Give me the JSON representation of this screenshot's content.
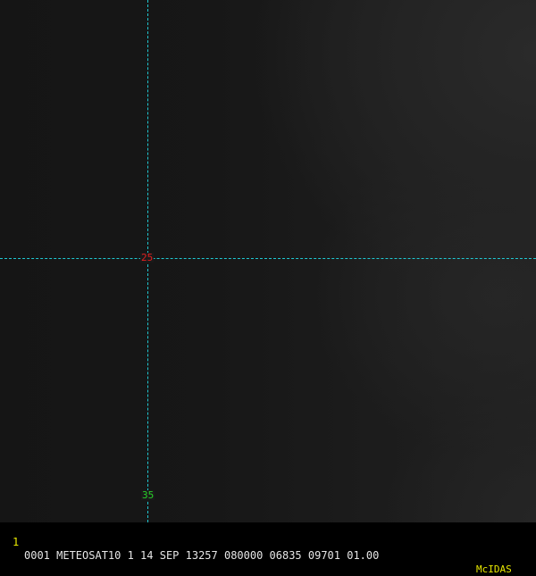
{
  "status_bar": {
    "frame_number": "1",
    "info": "0001 METEOSAT10 1 14 SEP 13257 080000 06835 09701 01.00",
    "brand": "McIDAS"
  },
  "grid_labels": {
    "lat_25": "25",
    "lat_35": "35"
  },
  "colors": {
    "grid_line": "#1fc8d2",
    "label_25": "#e02020",
    "label_35": "#28d028",
    "status_frame": "#e8e800",
    "status_text": "#e6e6e6"
  }
}
